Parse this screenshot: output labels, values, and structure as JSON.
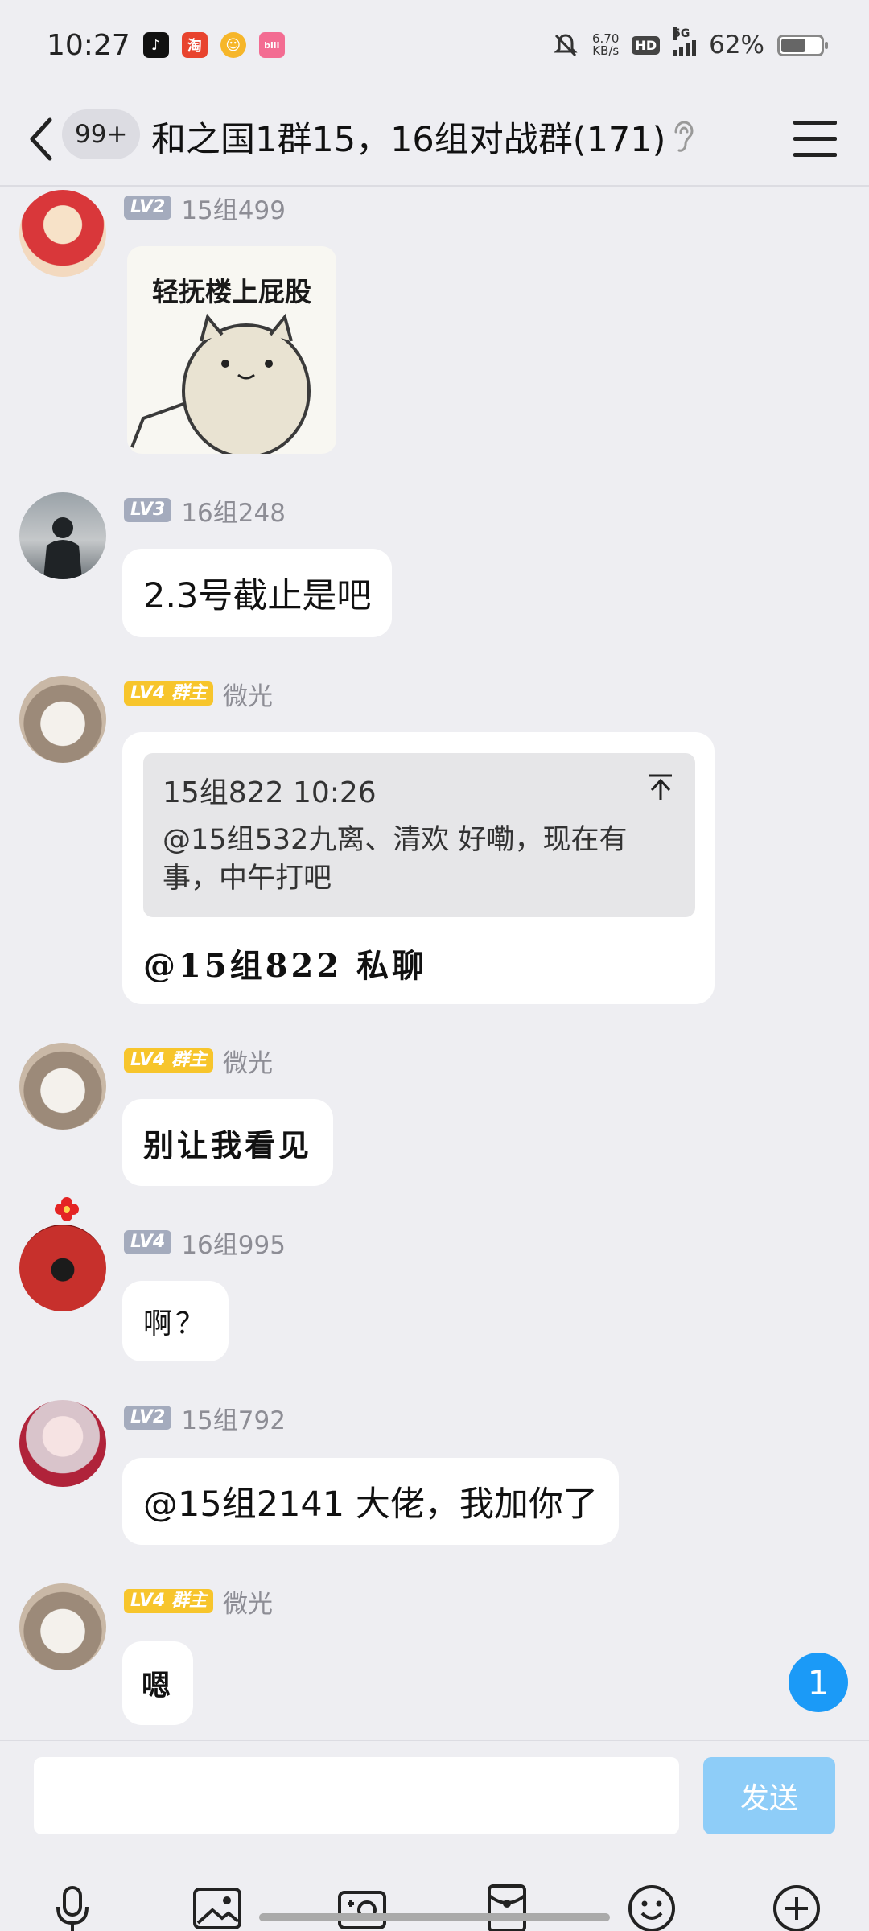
{
  "status_bar": {
    "time": "10:27",
    "notifications": [
      "tiktok-icon",
      "taobao-icon",
      "app-icon",
      "bilibili-icon"
    ],
    "notif_labels": {
      "taobao": "淘",
      "app": "☺",
      "bili": "bili"
    },
    "net_speed_value": "6.70",
    "net_speed_unit": "KB/s",
    "hd_label": "HD",
    "network_label": "5G",
    "battery_percent": "62%",
    "battery_level": 0.62
  },
  "header": {
    "unread_badge": "99+",
    "title": "和之国1群15，16组对战群(171)"
  },
  "messages": [
    {
      "level": "LV2",
      "sender": "15组499",
      "type": "sticker",
      "sticker_caption": "轻抚楼上屁股"
    },
    {
      "level": "LV3",
      "sender": "16组248",
      "type": "text",
      "text": "2.3号截止是吧"
    },
    {
      "level": "LV4",
      "role": "群主",
      "sender": "微光",
      "type": "reply",
      "quote_meta": "15组822 10:26",
      "quote_text": "@15组532九离、清欢 好嘞，现在有事，中午打吧",
      "text": "@15组822 私聊"
    },
    {
      "level": "LV4",
      "role": "群主",
      "sender": "微光",
      "type": "text",
      "text": "别让我看见"
    },
    {
      "level": "LV4",
      "sender": "16组995",
      "type": "text",
      "text": "啊？"
    },
    {
      "level": "LV2",
      "sender": "15组792",
      "type": "text",
      "text": "@15组2141 大佬，我加你了"
    },
    {
      "level": "LV4",
      "role": "群主",
      "sender": "微光",
      "type": "text",
      "text": "嗯"
    }
  ],
  "unread_float": "1",
  "input": {
    "placeholder": "",
    "send_label": "发送"
  },
  "toolbar": [
    "microphone-icon",
    "image-icon",
    "camera-icon",
    "red-packet-icon",
    "emoji-icon",
    "plus-icon"
  ],
  "colors": {
    "accent": "#1b9af7",
    "send_disabled": "#8ecdf8",
    "owner_badge": "#f7c52c",
    "level_badge": "#a4abbd",
    "background": "#eeeef2"
  }
}
